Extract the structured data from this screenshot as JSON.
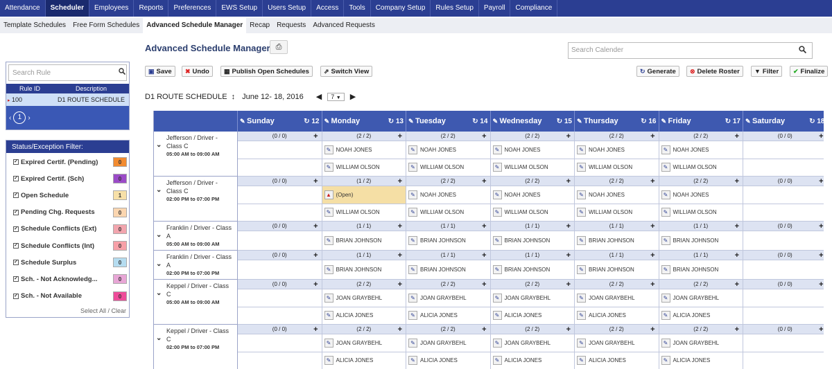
{
  "topnav": [
    "Attendance",
    "Scheduler",
    "Employees",
    "Reports",
    "Preferences",
    "EWS Setup",
    "Users Setup",
    "Access",
    "Tools",
    "Company Setup",
    "Rules Setup",
    "Payroll",
    "Compliance"
  ],
  "topnav_active": 1,
  "subnav": [
    "Template Schedules",
    "Free Form Schedules",
    "Advanced Schedule Manager",
    "Recap",
    "Requests",
    "Advanced Requests"
  ],
  "subnav_active": 2,
  "page_title": "Advanced Schedule Manager",
  "search_calendar_placeholder": "Search Calender",
  "search_rule": {
    "placeholder": "Search Rule",
    "col_rule_id": "Rule ID",
    "col_description": "Description",
    "row_id": "100",
    "row_description": "D1 ROUTE SCHEDULE",
    "page": "1"
  },
  "filter": {
    "title": "Status/Exception Filter:",
    "items": [
      {
        "label": "Expired Certif. (Pending)",
        "count": "0",
        "color": "#f28b30"
      },
      {
        "label": "Expired Certif. (Sch)",
        "count": "0",
        "color": "#9b4bc8"
      },
      {
        "label": "Open Schedule",
        "count": "1",
        "color": "#f7e0a8"
      },
      {
        "label": "Pending Chg. Requests",
        "count": "0",
        "color": "#fbd6b0"
      },
      {
        "label": "Schedule Conflicts (Ext)",
        "count": "0",
        "color": "#f2a5ae"
      },
      {
        "label": "Schedule Conflicts (Int)",
        "count": "0",
        "color": "#f7a0a8"
      },
      {
        "label": "Schedule Surplus",
        "count": "0",
        "color": "#b5dcf0"
      },
      {
        "label": "Sch. - Not Acknowledg...",
        "count": "0",
        "color": "#e8a6d6"
      },
      {
        "label": "Sch. - Not Available",
        "count": "0",
        "color": "#ee4c9a"
      }
    ],
    "select_all": "Select All / Clear"
  },
  "toolbar": {
    "save": "Save",
    "undo": "Undo",
    "publish": "Publish Open Schedules",
    "switch": "Switch View",
    "generate": "Generate",
    "delete_roster": "Delete Roster",
    "filter": "Filter",
    "finalize": "Finalize"
  },
  "schedule": {
    "name": "D1 ROUTE SCHEDULE",
    "range": "June 12- 18, 2016",
    "week_select": "7"
  },
  "days": [
    {
      "name": "Sunday",
      "num": "12"
    },
    {
      "name": "Monday",
      "num": "13"
    },
    {
      "name": "Tuesday",
      "num": "14"
    },
    {
      "name": "Wednesday",
      "num": "15"
    },
    {
      "name": "Thursday",
      "num": "16"
    },
    {
      "name": "Friday",
      "num": "17"
    },
    {
      "name": "Saturday",
      "num": "18"
    }
  ],
  "rows": [
    {
      "label": "Jefferson / Driver - Class C",
      "time": "05:00 AM to 09:00 AM",
      "counts": [
        "(0 / 0)",
        "(2 / 2)",
        "(2 / 2)",
        "(2 / 2)",
        "(2 / 2)",
        "(2 / 2)",
        "(0 / 0)"
      ],
      "emps": [
        "NOAH JONES",
        "WILLIAM OLSON"
      ],
      "open_monday": false
    },
    {
      "label": "Jefferson / Driver - Class C",
      "time": "02:00 PM to 07:00 PM",
      "counts": [
        "(0 / 0)",
        "(1 / 2)",
        "(2 / 2)",
        "(2 / 2)",
        "(2 / 2)",
        "(2 / 2)",
        "(0 / 0)"
      ],
      "emps": [
        "NOAH JONES",
        "WILLIAM OLSON"
      ],
      "open_monday": true,
      "open_label": "(Open)"
    },
    {
      "label": "Franklin / Driver - Class A",
      "time": "05:00 AM to 09:00 AM",
      "counts": [
        "(0 / 0)",
        "(1 / 1)",
        "(1 / 1)",
        "(1 / 1)",
        "(1 / 1)",
        "(1 / 1)",
        "(0 / 0)"
      ],
      "emps": [
        "BRIAN JOHNSON"
      ],
      "open_monday": false
    },
    {
      "label": "Franklin / Driver - Class A",
      "time": "02:00 PM to 07:00 PM",
      "counts": [
        "(0 / 0)",
        "(1 / 1)",
        "(1 / 1)",
        "(1 / 1)",
        "(1 / 1)",
        "(1 / 1)",
        "(0 / 0)"
      ],
      "emps": [
        "BRIAN JOHNSON"
      ],
      "open_monday": false
    },
    {
      "label": "Keppel / Driver - Class C",
      "time": "05:00 AM to 09:00 AM",
      "counts": [
        "(0 / 0)",
        "(2 / 2)",
        "(2 / 2)",
        "(2 / 2)",
        "(2 / 2)",
        "(2 / 2)",
        "(0 / 0)"
      ],
      "emps": [
        "JOAN GRAYBEHL",
        "ALICIA JONES"
      ],
      "open_monday": false
    },
    {
      "label": "Keppel / Driver - Class C",
      "time": "02:00 PM to 07:00 PM",
      "counts": [
        "(0 / 0)",
        "(2 / 2)",
        "(2 / 2)",
        "(2 / 2)",
        "(2 / 2)",
        "(2 / 2)",
        "(0 / 0)"
      ],
      "emps": [
        "JOAN GRAYBEHL",
        "ALICIA JONES"
      ],
      "open_monday": false
    }
  ]
}
